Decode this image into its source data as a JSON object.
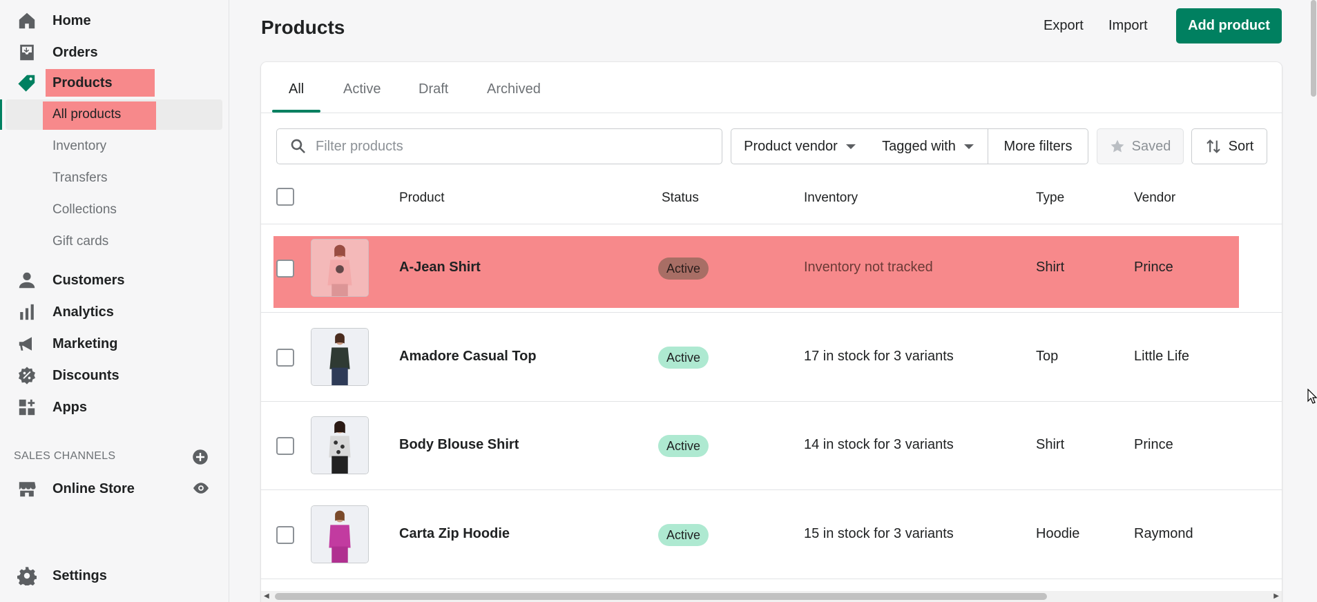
{
  "sidebar": {
    "items": [
      {
        "label": "Home",
        "icon": "home-icon"
      },
      {
        "label": "Orders",
        "icon": "orders-icon"
      },
      {
        "label": "Products",
        "icon": "tag-icon"
      }
    ],
    "sub_items": [
      {
        "label": "All products"
      },
      {
        "label": "Inventory"
      },
      {
        "label": "Transfers"
      },
      {
        "label": "Collections"
      },
      {
        "label": "Gift cards"
      }
    ],
    "items2": [
      {
        "label": "Customers",
        "icon": "person-icon"
      },
      {
        "label": "Analytics",
        "icon": "bar-chart-icon"
      },
      {
        "label": "Marketing",
        "icon": "megaphone-icon"
      },
      {
        "label": "Discounts",
        "icon": "discount-icon"
      },
      {
        "label": "Apps",
        "icon": "apps-icon"
      }
    ],
    "sales_channels_label": "SALES CHANNELS",
    "online_store_label": "Online Store",
    "settings_label": "Settings"
  },
  "header": {
    "title": "Products",
    "export_label": "Export",
    "import_label": "Import",
    "add_label": "Add product"
  },
  "tabs": [
    {
      "label": "All"
    },
    {
      "label": "Active"
    },
    {
      "label": "Draft"
    },
    {
      "label": "Archived"
    }
  ],
  "filters": {
    "search_placeholder": "Filter products",
    "vendor_label": "Product vendor",
    "tagged_label": "Tagged with",
    "more_label": "More filters",
    "saved_label": "Saved",
    "sort_label": "Sort"
  },
  "table": {
    "columns": [
      "Product",
      "Status",
      "Inventory",
      "Type",
      "Vendor"
    ],
    "rows": [
      {
        "name": "A-Jean Shirt",
        "status": "Active",
        "inventory": "Inventory not tracked",
        "type": "Shirt",
        "vendor": "Prince"
      },
      {
        "name": "Amadore Casual Top",
        "status": "Active",
        "inventory": "17 in stock for 3 variants",
        "type": "Top",
        "vendor": "Little Life"
      },
      {
        "name": "Body Blouse Shirt",
        "status": "Active",
        "inventory": "14 in stock for 3 variants",
        "type": "Shirt",
        "vendor": "Prince"
      },
      {
        "name": "Carta Zip Hoodie",
        "status": "Active",
        "inventory": "15 in stock for 3 variants",
        "type": "Hoodie",
        "vendor": "Raymond"
      }
    ]
  },
  "colors": {
    "brand": "#008060",
    "highlight": "#f7898b",
    "badge_active_bg": "#aee9d1"
  }
}
